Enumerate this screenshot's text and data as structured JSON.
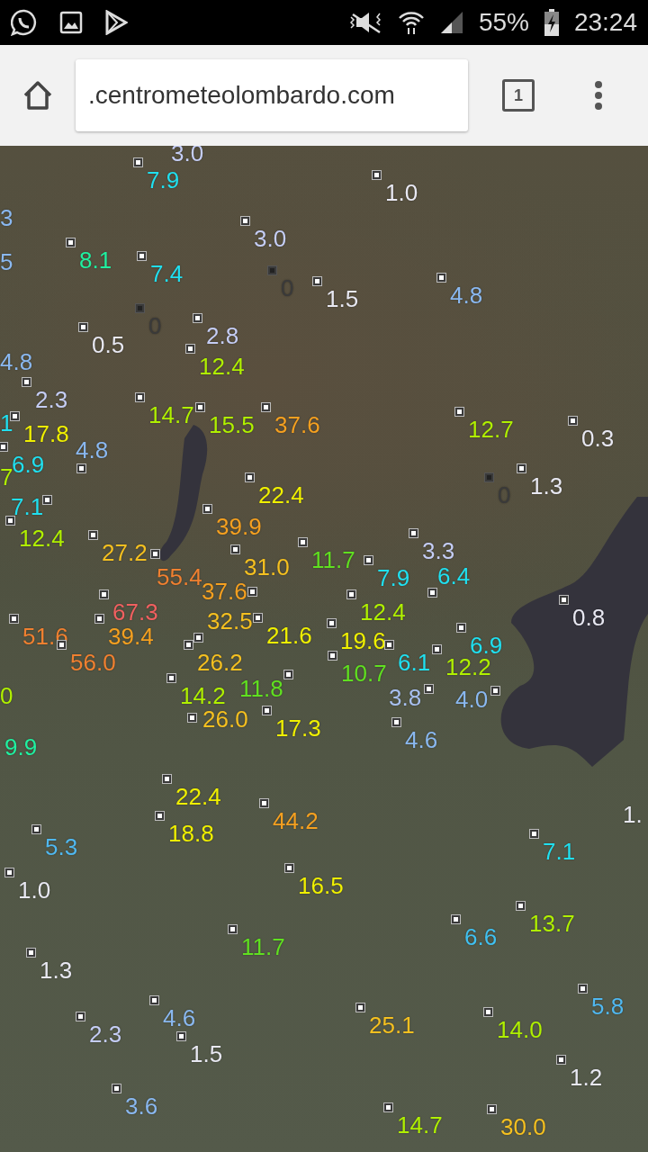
{
  "status_bar": {
    "battery": "55%",
    "time": "23:24"
  },
  "browser": {
    "url": ".centrometeolombardo.com",
    "tab_count": "1"
  },
  "map": {
    "stations": [
      {
        "value": "3.0",
        "color": "#c5cdf5"
      },
      {
        "value": "7.9",
        "color": "#20e0f0"
      },
      {
        "value": "3",
        "color": "#8ab8f0"
      },
      {
        "value": "3.0",
        "color": "#c5cdf5"
      },
      {
        "value": "8.1",
        "color": "#20f0a0"
      },
      {
        "value": "7.4",
        "color": "#20e0f0"
      },
      {
        "value": "5",
        "color": "#8ab8f0"
      },
      {
        "value": "1.0",
        "color": "#e8e8f2"
      },
      {
        "value": "0",
        "color": "#3a3a3a"
      },
      {
        "value": "1.5",
        "color": "#e8e8f2"
      },
      {
        "value": "4.8",
        "color": "#8ab8f0"
      },
      {
        "value": "0",
        "color": "#3a3a3a"
      },
      {
        "value": "0.5",
        "color": "#e8e8f2"
      },
      {
        "value": "2.8",
        "color": "#c5cdf5"
      },
      {
        "value": "4.8",
        "color": "#8ab8f0"
      },
      {
        "value": "12.4",
        "color": "#b0f000"
      },
      {
        "value": "2.3",
        "color": "#c5cdf5"
      },
      {
        "value": "1",
        "color": "#20e0f0"
      },
      {
        "value": "17.8",
        "color": "#f0f000"
      },
      {
        "value": "14.7",
        "color": "#b0f000"
      },
      {
        "value": "15.5",
        "color": "#b0f000"
      },
      {
        "value": "37.6",
        "color": "#f5a020"
      },
      {
        "value": "12.7",
        "color": "#b0f000"
      },
      {
        "value": "0.3",
        "color": "#e8e8f2"
      },
      {
        "value": "6.9",
        "color": "#20e0f0"
      },
      {
        "value": "4.8",
        "color": "#8ab8f0"
      },
      {
        "value": "7",
        "color": "#b0f000"
      },
      {
        "value": "22.4",
        "color": "#f0f000"
      },
      {
        "value": "0",
        "color": "#3a3a3a"
      },
      {
        "value": "1.3",
        "color": "#e8e8f2"
      },
      {
        "value": "7.1",
        "color": "#20e0f0"
      },
      {
        "value": "39.9",
        "color": "#f5a020"
      },
      {
        "value": "12.4",
        "color": "#b0f000"
      },
      {
        "value": "27.2",
        "color": "#f5c020"
      },
      {
        "value": "3.3",
        "color": "#c5cdf5"
      },
      {
        "value": "55.4",
        "color": "#f08030"
      },
      {
        "value": "37.6",
        "color": "#f5a020"
      },
      {
        "value": "31.0",
        "color": "#f5c020"
      },
      {
        "value": "11.7",
        "color": "#60e020"
      },
      {
        "value": "7.9",
        "color": "#20e0f0"
      },
      {
        "value": "6.4",
        "color": "#20e0f0"
      },
      {
        "value": "67.3",
        "color": "#f06060"
      },
      {
        "value": "12.4",
        "color": "#b0f000"
      },
      {
        "value": "0.8",
        "color": "#e8e8f2"
      },
      {
        "value": "51.6",
        "color": "#f08030"
      },
      {
        "value": "39.4",
        "color": "#f5a020"
      },
      {
        "value": "32.5",
        "color": "#f5c020"
      },
      {
        "value": "21.6",
        "color": "#f0f000"
      },
      {
        "value": "19.6",
        "color": "#f0f000"
      },
      {
        "value": "6.9",
        "color": "#20e0f0"
      },
      {
        "value": "56.0",
        "color": "#f08030"
      },
      {
        "value": "26.2",
        "color": "#f5c020"
      },
      {
        "value": "10.7",
        "color": "#60e020"
      },
      {
        "value": "6.1",
        "color": "#20e0f0"
      },
      {
        "value": "12.2",
        "color": "#b0f000"
      },
      {
        "value": "0",
        "color": "#b0f000"
      },
      {
        "value": "14.2",
        "color": "#b0f000"
      },
      {
        "value": "11.8",
        "color": "#60e020"
      },
      {
        "value": "3.8",
        "color": "#a8c0f0"
      },
      {
        "value": "4.0",
        "color": "#8ab8f0"
      },
      {
        "value": "26.0",
        "color": "#f5c020"
      },
      {
        "value": "17.3",
        "color": "#f0f000"
      },
      {
        "value": "4.6",
        "color": "#8ab8f0"
      },
      {
        "value": "9.9",
        "color": "#20f0a0"
      },
      {
        "value": "22.4",
        "color": "#f0f000"
      },
      {
        "value": "1.",
        "color": "#e8e8f2"
      },
      {
        "value": "18.8",
        "color": "#f0f000"
      },
      {
        "value": "44.2",
        "color": "#f5a020"
      },
      {
        "value": "5.3",
        "color": "#50b8f0"
      },
      {
        "value": "7.1",
        "color": "#20e0f0"
      },
      {
        "value": "1.0",
        "color": "#e8e8f2"
      },
      {
        "value": "16.5",
        "color": "#f0f000"
      },
      {
        "value": "13.7",
        "color": "#b0f000"
      },
      {
        "value": "6.6",
        "color": "#40c0f0"
      },
      {
        "value": "11.7",
        "color": "#60e020"
      },
      {
        "value": "1.3",
        "color": "#e8e8f2"
      },
      {
        "value": "5.8",
        "color": "#50b8f0"
      },
      {
        "value": "4.6",
        "color": "#8ab8f0"
      },
      {
        "value": "2.3",
        "color": "#c5cdf5"
      },
      {
        "value": "25.1",
        "color": "#f5c020"
      },
      {
        "value": "14.0",
        "color": "#b0f000"
      },
      {
        "value": "1.5",
        "color": "#e8e8f2"
      },
      {
        "value": "1.2",
        "color": "#e8e8f2"
      },
      {
        "value": "3.6",
        "color": "#8ab8f0"
      },
      {
        "value": "14.7",
        "color": "#b0f000"
      },
      {
        "value": "30.0",
        "color": "#f5c020"
      }
    ]
  }
}
